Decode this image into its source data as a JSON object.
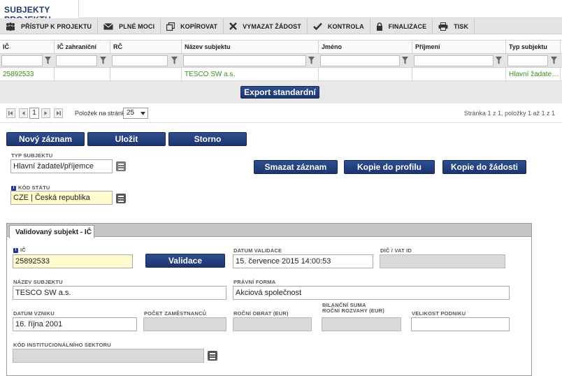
{
  "page_title": "SUBJEKTY PROJEKTU",
  "toolbar": [
    {
      "label": "PŘÍSTUP K PROJEKTU",
      "icon": "people-icon"
    },
    {
      "label": "PLNÉ MOCI",
      "icon": "envelope-icon"
    },
    {
      "label": "KOPÍROVAT",
      "icon": "copy-icon"
    },
    {
      "label": "VYMAZAT ŽÁDOST",
      "icon": "x-icon"
    },
    {
      "label": "KONTROLA",
      "icon": "check-icon"
    },
    {
      "label": "FINALIZACE",
      "icon": "lock-icon"
    },
    {
      "label": "TISK",
      "icon": "printer-icon"
    }
  ],
  "grid": {
    "columns": [
      "IČ",
      "IČ zahraniční",
      "RČ",
      "Název subjektu",
      "Jméno",
      "Příjmení",
      "Typ subjektu"
    ],
    "rows": [
      [
        "25892533",
        "",
        "",
        "TESCO SW a.s.",
        "",
        "",
        "Hlavní žadate…"
      ]
    ],
    "export_label": "Export standardní"
  },
  "pager": {
    "current_page": "1",
    "per_page_label": "Položek na stránku",
    "per_page_value": "25",
    "info": "Stránka 1 z 1, položky 1 až 1 z 1"
  },
  "actions": {
    "new": "Nový záznam",
    "save": "Uložit",
    "cancel": "Storno",
    "delete": "Smazat záznam",
    "copy_profile": "Kopie do profilu",
    "copy_request": "Kopie do žádosti"
  },
  "form": {
    "typ_subjektu_label": "TYP SUBJEKTU",
    "typ_subjektu_value": "Hlavní žadatel/příjemce",
    "kod_statu_label": "KÓD STÁTU",
    "kod_statu_value": "CZE | Česká republika"
  },
  "panel": {
    "tab_label": "Validovaný subjekt - IČ",
    "ic_label": "IČ",
    "ic_value": "25892533",
    "validate_button": "Validace",
    "datum_validace_label": "DATUM VALIDACE",
    "datum_validace_value": "15. července 2015 14:00:53",
    "dic_label": "DIČ / VAT ID",
    "dic_value": "",
    "nazev_label": "NÁZEV SUBJEKTU",
    "nazev_value": "TESCO SW a.s.",
    "pravni_forma_label": "PRÁVNÍ FORMA",
    "pravni_forma_value": "Akciová společnost",
    "datum_vzniku_label": "DATUM VZNIKU",
    "datum_vzniku_value": "16. října 2001",
    "pocet_zam_label": "POČET ZAMĚSTNANCŮ",
    "rocni_obrat_label": "ROČNÍ OBRAT (EUR)",
    "bilancni_label_1": "BILANČNÍ SUMA",
    "bilancni_label_2": "ROČNÍ ROZVAHY (EUR)",
    "velikost_label": "VELIKOST PODNIKU",
    "kod_inst_label": "KÓD INSTITUCIONÁLNÍHO SEKTORU"
  },
  "colors": {
    "accent": "#1c3670",
    "link_green": "#3a8f19",
    "required_yellow": "#fffbcf"
  }
}
